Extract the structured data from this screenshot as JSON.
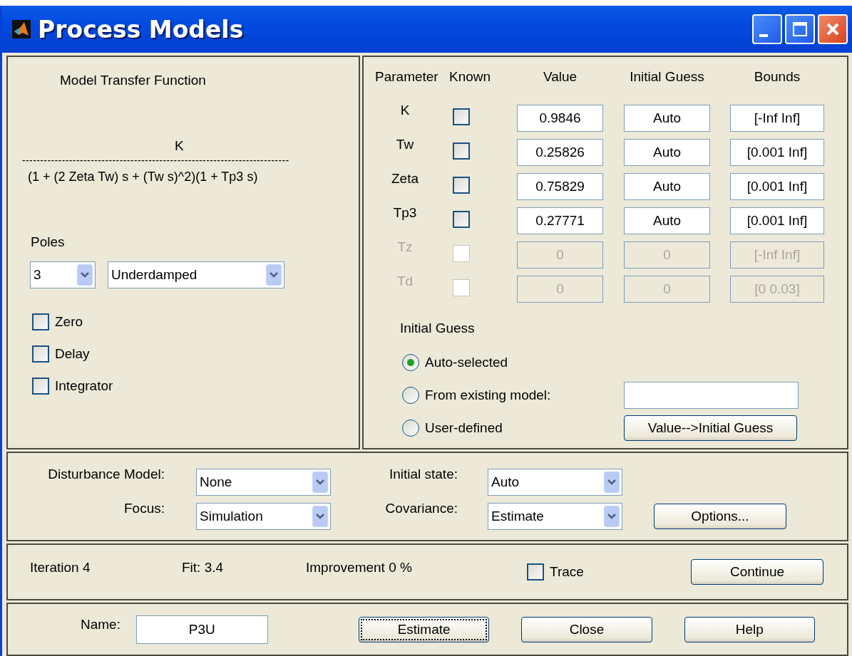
{
  "window": {
    "title": "Process Models"
  },
  "model": {
    "heading": "Model Transfer Function",
    "numerator": "K",
    "divider": "--------------------------------------------------------------------------",
    "denominator": "(1 + (2 Zeta Tw) s + (Tw s)^2)(1 + Tp3 s)"
  },
  "poles": {
    "label": "Poles",
    "count": "3",
    "type": "Underdamped"
  },
  "options": [
    {
      "label": "Zero",
      "checked": false
    },
    {
      "label": "Delay",
      "checked": false
    },
    {
      "label": "Integrator",
      "checked": false
    }
  ],
  "parameters": {
    "columns": [
      "Parameter",
      "Known",
      "Value",
      "Initial Guess",
      "Bounds"
    ],
    "rows": [
      {
        "name": "K",
        "known": false,
        "enabled": true,
        "value": "0.9846",
        "initial_guess": "Auto",
        "bounds": "[-Inf Inf]"
      },
      {
        "name": "Tw",
        "known": false,
        "enabled": true,
        "value": "0.25826",
        "initial_guess": "Auto",
        "bounds": "[0.001 Inf]"
      },
      {
        "name": "Zeta",
        "known": false,
        "enabled": true,
        "value": "0.75829",
        "initial_guess": "Auto",
        "bounds": "[0.001 Inf]"
      },
      {
        "name": "Tp3",
        "known": false,
        "enabled": true,
        "value": "0.27771",
        "initial_guess": "Auto",
        "bounds": "[0.001 Inf]"
      },
      {
        "name": "Tz",
        "known": false,
        "enabled": false,
        "value": "0",
        "initial_guess": "0",
        "bounds": "[-Inf Inf]"
      },
      {
        "name": "Td",
        "known": false,
        "enabled": false,
        "value": "0",
        "initial_guess": "0",
        "bounds": "[0 0.03]"
      }
    ]
  },
  "initial_guess": {
    "label": "Initial Guess",
    "options": [
      {
        "label": "Auto-selected",
        "selected": true
      },
      {
        "label": "From existing model:",
        "selected": false
      },
      {
        "label": "User-defined",
        "selected": false
      }
    ],
    "button": "Value-->Initial Guess"
  },
  "estimation": {
    "disturbance_model": {
      "label": "Disturbance Model:",
      "value": "None"
    },
    "focus": {
      "label": "Focus:",
      "value": "Simulation"
    },
    "initial_state": {
      "label": "Initial state:",
      "value": "Auto"
    },
    "covariance": {
      "label": "Covariance:",
      "value": "Estimate"
    },
    "options_button": "Options..."
  },
  "progress": {
    "iteration": "Iteration 4",
    "fit": "Fit: 3.4",
    "improvement": "Improvement 0 %",
    "trace": {
      "label": "Trace",
      "checked": false
    },
    "continue_button": "Continue"
  },
  "footer": {
    "name_label": "Name:",
    "name_value": "P3U",
    "buttons": [
      {
        "label": "Estimate",
        "focused": true
      },
      {
        "label": "Close",
        "focused": false
      },
      {
        "label": "Help",
        "focused": false
      }
    ]
  }
}
